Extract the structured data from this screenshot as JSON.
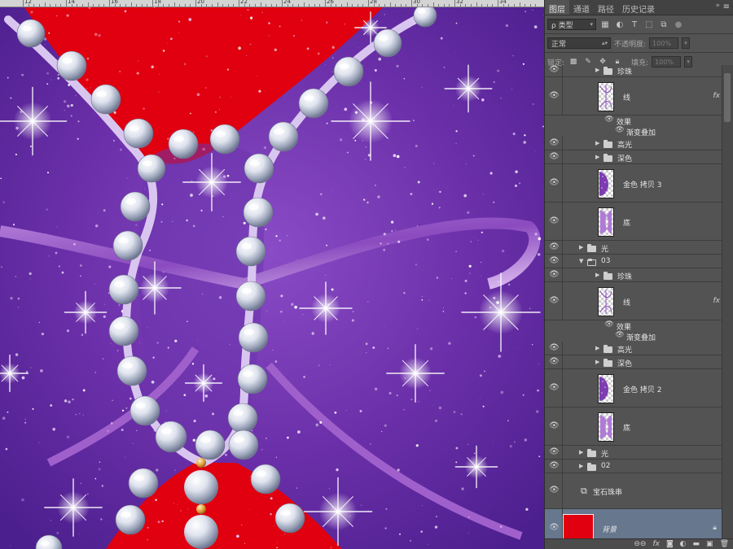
{
  "ruler": {
    "labels": [
      "12",
      "14",
      "16",
      "18",
      "20",
      "22",
      "24",
      "26",
      "28",
      "30",
      "32",
      "34"
    ]
  },
  "panel": {
    "tabs": [
      {
        "label": "图层",
        "active": true
      },
      {
        "label": "通道",
        "active": false
      },
      {
        "label": "路径",
        "active": false
      },
      {
        "label": "历史记录",
        "active": false
      }
    ],
    "collapse_icon": "double-chevron-icon",
    "menu_icon": "panel-menu-icon",
    "filter": {
      "label": "ρ 类型"
    },
    "blend_mode": "正常",
    "opacity": {
      "label": "不透明度:",
      "value": "100%"
    },
    "lock": {
      "label": "锁定:"
    },
    "fill": {
      "label": "填充:",
      "value": "100%"
    },
    "accent_color": "#e0000f"
  },
  "layers": [
    {
      "name": "珍珠",
      "kind": "group",
      "open": false,
      "indent": 2
    },
    {
      "name": "线",
      "kind": "layer",
      "fx": true,
      "indent": 2
    },
    {
      "name": "效果",
      "kind": "effects-header",
      "indent": 2
    },
    {
      "name": "渐变叠加",
      "kind": "effect",
      "indent": 2
    },
    {
      "name": "高光",
      "kind": "group",
      "open": false,
      "indent": 2
    },
    {
      "name": "深色",
      "kind": "group",
      "open": false,
      "indent": 2
    },
    {
      "name": "金色 拷贝 3",
      "kind": "layer",
      "indent": 2
    },
    {
      "name": "底",
      "kind": "layer",
      "indent": 2
    },
    {
      "name": "光",
      "kind": "group",
      "open": false,
      "indent": 1
    },
    {
      "name": "03",
      "kind": "group",
      "open": true,
      "indent": 1
    },
    {
      "name": "珍珠",
      "kind": "group",
      "open": false,
      "indent": 2
    },
    {
      "name": "线",
      "kind": "layer",
      "fx": true,
      "indent": 2
    },
    {
      "name": "效果",
      "kind": "effects-header",
      "indent": 2
    },
    {
      "name": "渐变叠加",
      "kind": "effect",
      "indent": 2
    },
    {
      "name": "高光",
      "kind": "group",
      "open": false,
      "indent": 2
    },
    {
      "name": "深色",
      "kind": "group",
      "open": false,
      "indent": 2
    },
    {
      "name": "金色 拷贝 2",
      "kind": "layer",
      "indent": 2
    },
    {
      "name": "底",
      "kind": "layer",
      "indent": 2
    },
    {
      "name": "光",
      "kind": "group",
      "open": false,
      "indent": 1
    },
    {
      "name": "02",
      "kind": "group",
      "open": false,
      "indent": 1
    },
    {
      "name": "宝石珠串",
      "kind": "smart-object",
      "indent": 1
    },
    {
      "name": "背景",
      "kind": "background",
      "locked": true,
      "indent": 1
    }
  ],
  "bottom_icons": [
    "link-icon",
    "fx-icon",
    "mask-icon",
    "adjustment-icon",
    "new-group-icon",
    "new-layer-icon",
    "trash-icon"
  ]
}
